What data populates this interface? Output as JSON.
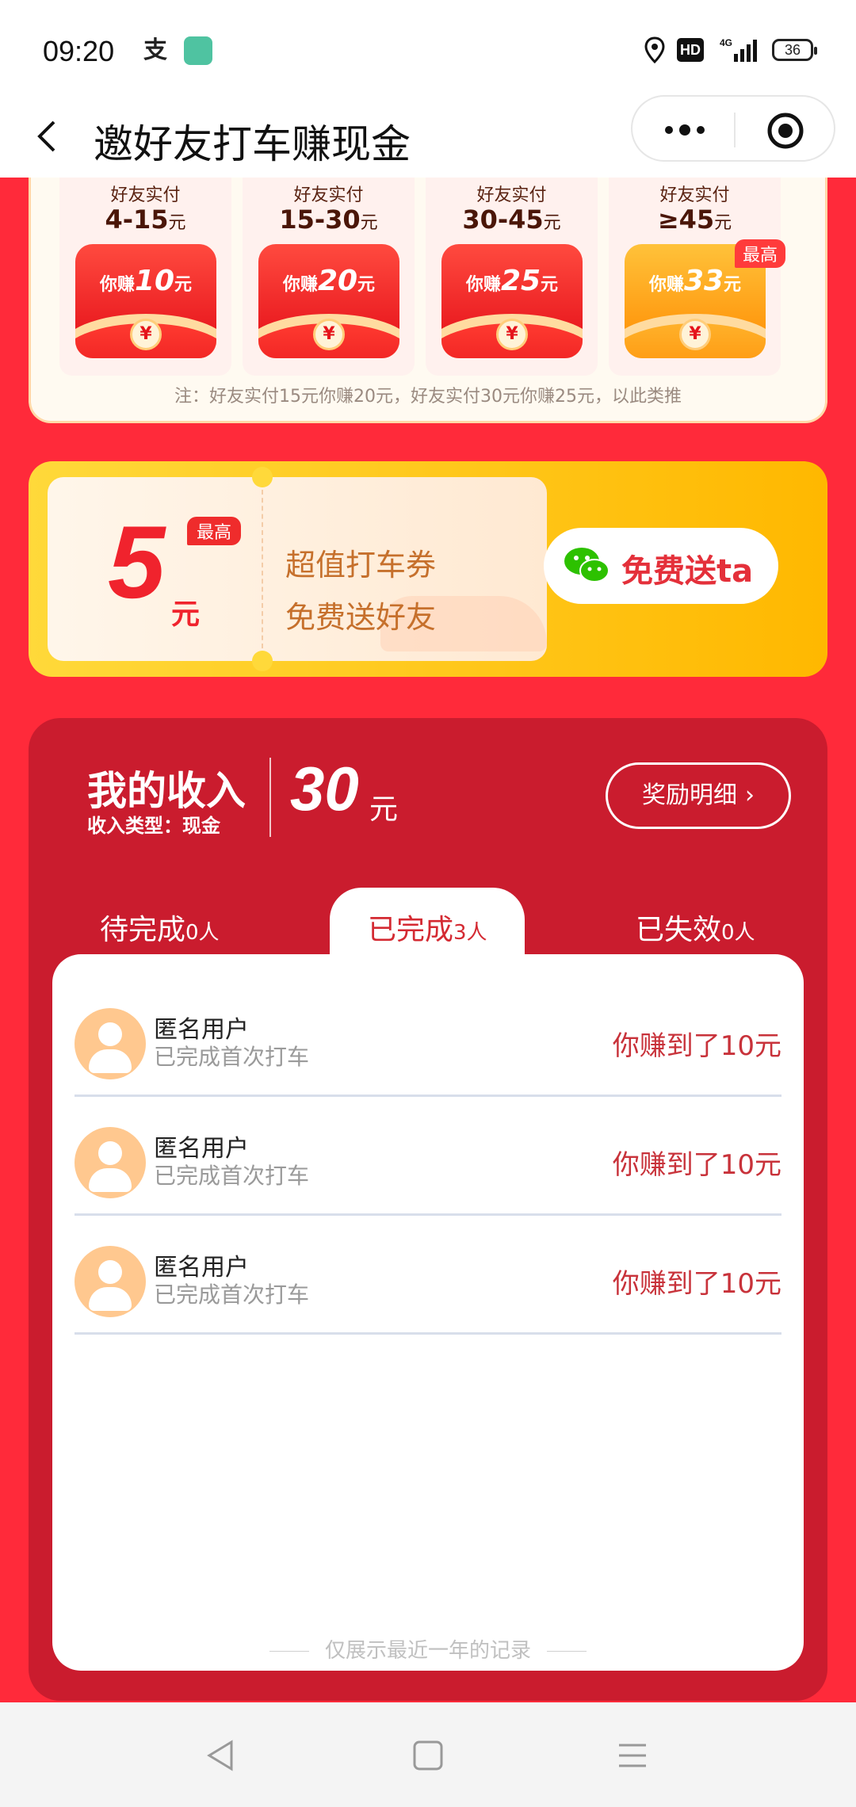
{
  "status": {
    "time": "09:20",
    "hd": "HD",
    "network": "4G",
    "battery": "36"
  },
  "nav": {
    "title": "邀好友打车赚现金"
  },
  "rewards": {
    "tiers": [
      {
        "label": "好友实付",
        "range": "4-15",
        "unit": "元",
        "earn_prefix": "你赚",
        "earn": "10",
        "earn_unit": "元",
        "badge": ""
      },
      {
        "label": "好友实付",
        "range": "15-30",
        "unit": "元",
        "earn_prefix": "你赚",
        "earn": "20",
        "earn_unit": "元",
        "badge": ""
      },
      {
        "label": "好友实付",
        "range": "30-45",
        "unit": "元",
        "earn_prefix": "你赚",
        "earn": "25",
        "earn_unit": "元",
        "badge": ""
      },
      {
        "label": "好友实付",
        "range": "≥45",
        "unit": "元",
        "earn_prefix": "你赚",
        "earn": "33",
        "earn_unit": "元",
        "badge": "最高"
      }
    ],
    "note": "注：好友实付15元你赚20元，好友实付30元你赚25元，以此类推"
  },
  "coupon": {
    "amount": "5",
    "unit": "元",
    "badge": "最高",
    "line1": "超值打车券",
    "line2": "免费送好友",
    "share_label": "免费送ta"
  },
  "income": {
    "title": "我的收入",
    "type_label": "收入类型：现金",
    "amount": "30",
    "unit": "元",
    "detail_label": "奖励明细",
    "tabs": [
      {
        "label": "待完成",
        "count": "0人"
      },
      {
        "label": "已完成",
        "count": "3人"
      },
      {
        "label": "已失效",
        "count": "0人"
      }
    ],
    "records": [
      {
        "name": "匿名用户",
        "status": "已完成首次打车",
        "earned": "你赚到了10元"
      },
      {
        "name": "匿名用户",
        "status": "已完成首次打车",
        "earned": "你赚到了10元"
      },
      {
        "name": "匿名用户",
        "status": "已完成首次打车",
        "earned": "你赚到了10元"
      }
    ],
    "footer": "仅展示最近一年的记录"
  },
  "colors": {
    "page_bg": "#ff2a3a",
    "panel": "#ca1c2e",
    "accent_red": "#e4303a",
    "coupon_gold": "#ffb800"
  }
}
